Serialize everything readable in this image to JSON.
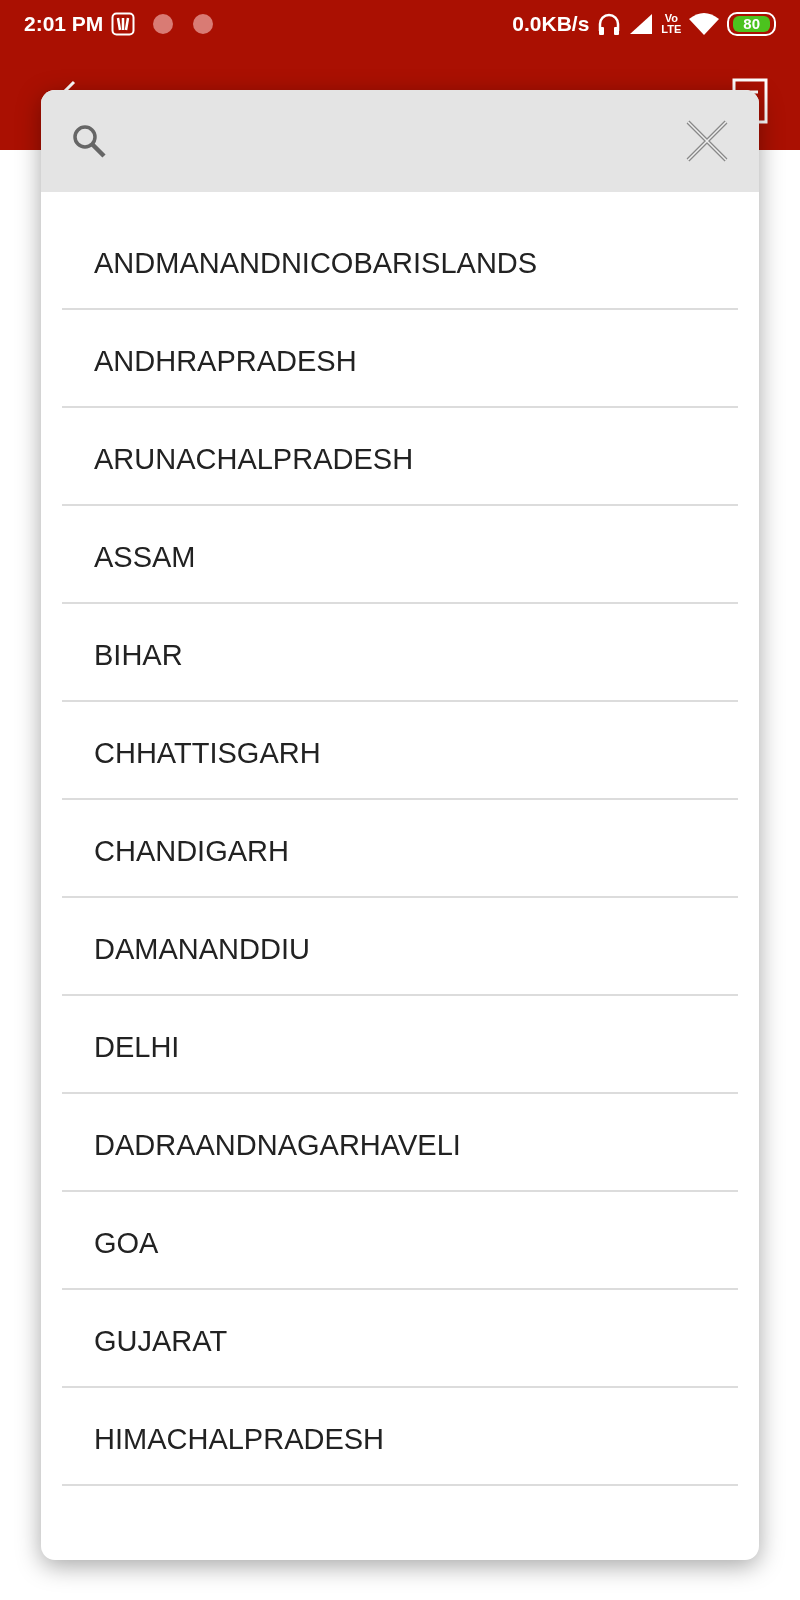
{
  "status_bar": {
    "time": "2:01 PM",
    "network_speed": "0.0KB/s",
    "volte_top": "Vo",
    "volte_bottom": "LTE",
    "battery": "80"
  },
  "dialog": {
    "items": [
      {
        "label": "ANDMANANDNICOBARISLANDS"
      },
      {
        "label": "ANDHRAPRADESH"
      },
      {
        "label": "ARUNACHALPRADESH"
      },
      {
        "label": "ASSAM"
      },
      {
        "label": "BIHAR"
      },
      {
        "label": "CHHATTISGARH"
      },
      {
        "label": "CHANDIGARH"
      },
      {
        "label": "DAMANANDDIU"
      },
      {
        "label": "DELHI"
      },
      {
        "label": "DADRAANDNAGARHAVELI"
      },
      {
        "label": "GOA"
      },
      {
        "label": "GUJARAT"
      },
      {
        "label": "HIMACHALPRADESH"
      }
    ]
  }
}
